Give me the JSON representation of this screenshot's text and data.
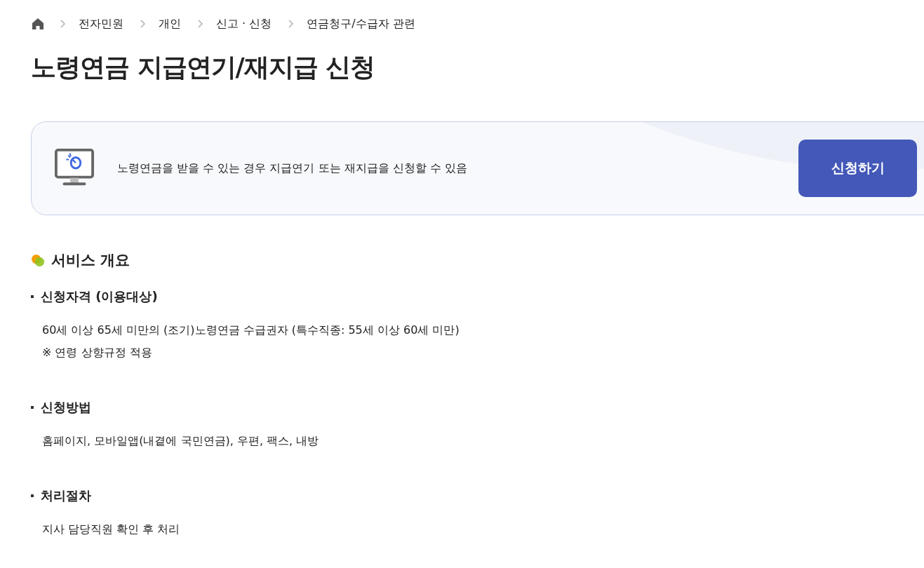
{
  "breadcrumb": [
    "전자민원",
    "개인",
    "신고 · 신청",
    "연금청구/수급자 관련"
  ],
  "title": "노령연금 지급연기/재지급 신청",
  "banner": {
    "description": "노령연금을 받을 수 있는 경우 지급연기 또는 재지급을 신청할 수 있음",
    "button": "신청하기"
  },
  "overview": {
    "heading": "서비스 개요",
    "sections": [
      {
        "heading": "신청자격 (이용대상)",
        "lines": [
          "60세 이상 65세 미만의 (조기)노령연금 수급권자 (특수직종: 55세 이상 60세 미만)",
          "※ 연령 상향규정 적용"
        ]
      },
      {
        "heading": "신청방법",
        "lines": [
          "홈페이지, 모바일앱(내곁에 국민연금), 우편, 팩스, 내방"
        ]
      },
      {
        "heading": "처리절차",
        "lines": [
          "지사 담당직원 확인 후 처리"
        ]
      }
    ]
  }
}
